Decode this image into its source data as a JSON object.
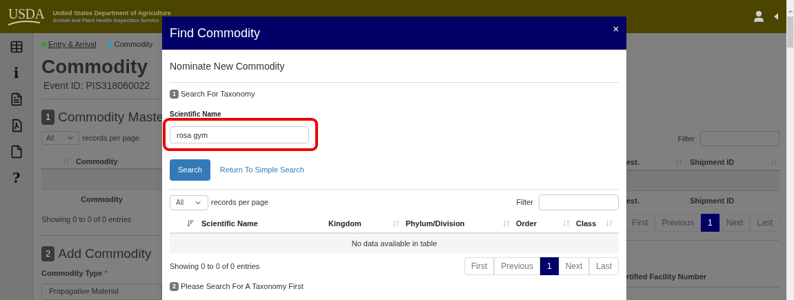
{
  "header": {
    "logo": "USDA",
    "agency": "United States Department of Agriculture",
    "service": "Animal and Plant Health Inspection Service"
  },
  "sidebar": {
    "items": [
      {
        "kind": "table"
      },
      {
        "kind": "text",
        "label": "i"
      },
      {
        "kind": "document"
      },
      {
        "kind": "pdf"
      },
      {
        "kind": "blank"
      },
      {
        "kind": "text",
        "label": "?"
      }
    ]
  },
  "breadcrumbs": [
    {
      "label": "Entry & Arrival",
      "color": "#22aa22",
      "link": true
    },
    {
      "label": "Commodity",
      "color": "#3399bb",
      "link": false
    }
  ],
  "page": {
    "title": "Commodity",
    "event_id": "Event ID: PIS318060022"
  },
  "master": {
    "number": "1",
    "title": "Commodity Maste",
    "length": {
      "value": "All",
      "label": "records per page"
    },
    "filter_label": "Filter",
    "columns": [
      "Commodity",
      "est.",
      "Shipment ID"
    ],
    "footer_columns": [
      "Commodity",
      "est.",
      "Shipment ID"
    ],
    "info": "Showing 0 to 0 of 0 entries",
    "pages": [
      {
        "label": "First",
        "selected": false
      },
      {
        "label": "Previous",
        "selected": false
      },
      {
        "label": "1",
        "selected": true
      },
      {
        "label": "Next",
        "selected": false
      },
      {
        "label": "Last",
        "selected": false
      }
    ]
  },
  "add": {
    "number": "2",
    "title": "Add Commodity",
    "type_label": "Commodity Type",
    "required": "*",
    "type_value": "Propagative Material",
    "facility_label": "rtified Facility Number"
  },
  "modal": {
    "title": "Find Commodity",
    "close": "×",
    "subtitle": "Nominate New Commodity",
    "step1": {
      "number": "1",
      "label": "Search For Taxonomy"
    },
    "field_label": "Scientific Name",
    "field_value": "rosa gym",
    "search_button": "Search",
    "simple_link": "Return To Simple Search",
    "length": {
      "value": "All",
      "label": "records per page"
    },
    "filter_label": "Filter",
    "columns": [
      {
        "label": "Scientific Name",
        "sorted": true
      },
      {
        "label": "Kingdom",
        "sorted": false
      },
      {
        "label": "Phylum/Division",
        "sorted": false
      },
      {
        "label": "Order",
        "sorted": false
      },
      {
        "label": "Class",
        "sorted": false
      }
    ],
    "empty": "No data available in table",
    "info": "Showing 0 to 0 of 0 entries",
    "pages": [
      {
        "label": "First",
        "selected": false
      },
      {
        "label": "Previous",
        "selected": false
      },
      {
        "label": "1",
        "selected": true
      },
      {
        "label": "Next",
        "selected": false
      },
      {
        "label": "Last",
        "selected": false
      }
    ],
    "step2": {
      "number": "2",
      "label": "Please Search For A Taxonomy First"
    }
  }
}
